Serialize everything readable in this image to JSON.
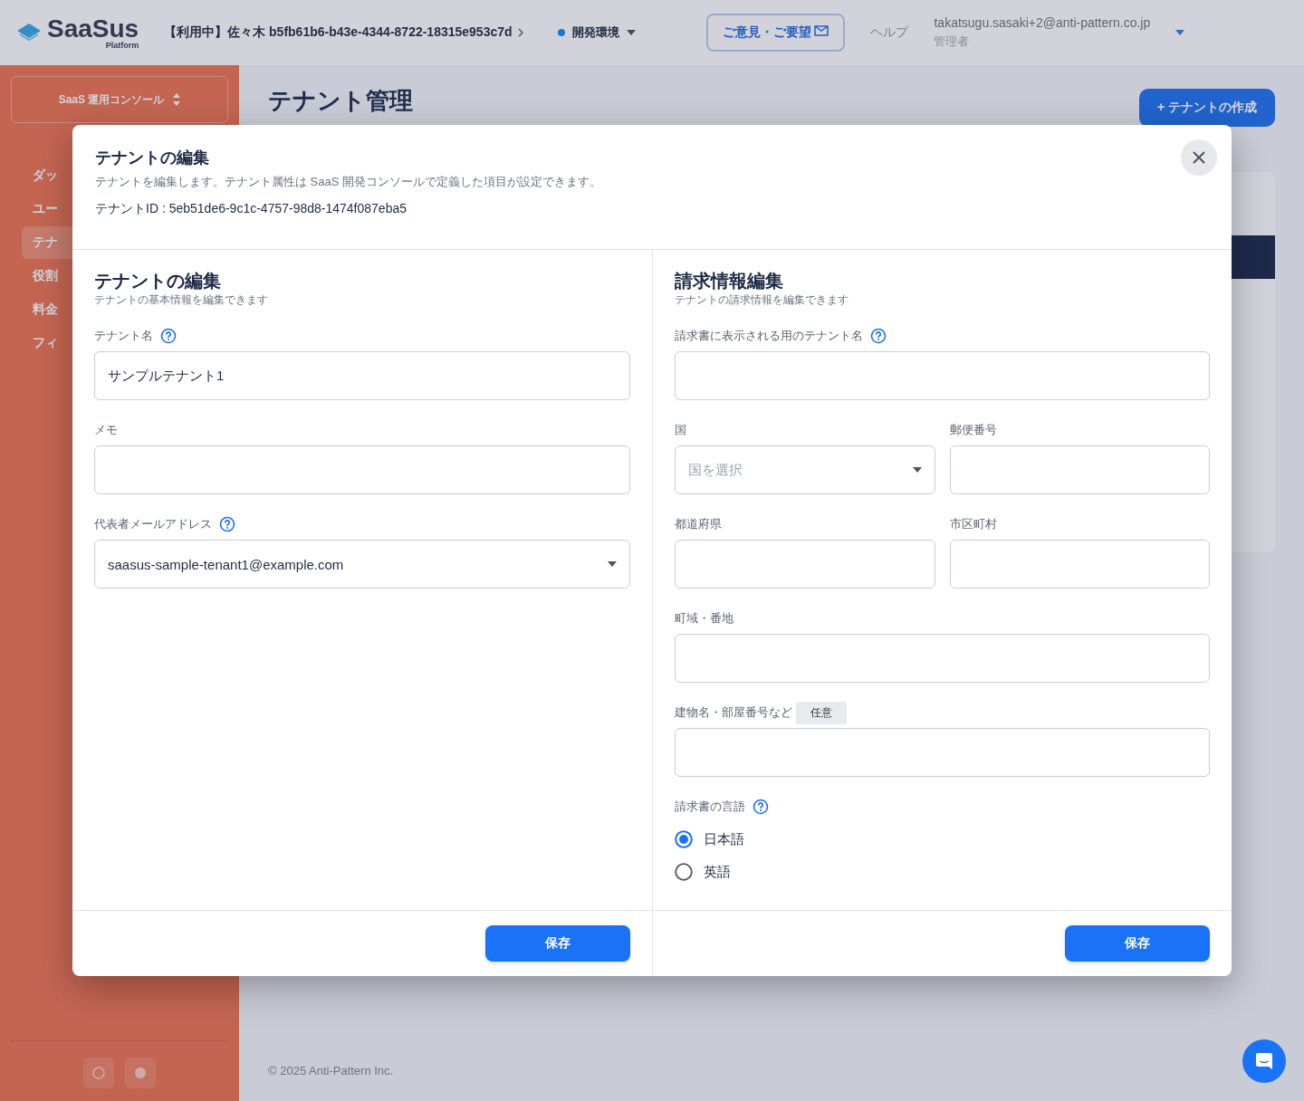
{
  "header": {
    "logo": {
      "name": "SaaSus",
      "sub": "Platform"
    },
    "tenant_selector": "【利用中】佐々木 b5fb61b6-b43e-4344-8722-18315e953c7d",
    "environment": "開発環境",
    "feedback_button": "ご意見・ご要望",
    "help_link": "ヘルプ",
    "user": {
      "email": "takatsugu.sasaki+2@anti-pattern.co.jp",
      "role": "管理者"
    }
  },
  "sidebar": {
    "console_selector": "SaaS 運用コンソール",
    "items": [
      {
        "label": "ダッ",
        "selected": false
      },
      {
        "label": "ユー",
        "selected": false
      },
      {
        "label": "テナ",
        "selected": true
      },
      {
        "label": "役割",
        "selected": false
      },
      {
        "label": "料金",
        "selected": false
      },
      {
        "label": "フィ",
        "selected": false
      }
    ]
  },
  "page": {
    "title": "テナント管理",
    "create_button": "+ テナントの作成",
    "footer": "© 2025 Anti-Pattern Inc."
  },
  "dialog": {
    "title": "テナントの編集",
    "description": "テナントを編集します。テナント属性は SaaS 開発コンソールで定義した項目が設定できます。",
    "tenant_id": "テナントID : 5eb51de6-9c1c-4757-98d8-1474f087eba5",
    "sections": [
      {
        "title": "テナントの編集",
        "subtitle": "テナントの基本情報を編集できます",
        "save_button": "保存",
        "rows": [
          [
            {
              "kind": "text",
              "label": "テナント名",
              "help": true,
              "value": "サンプルテナント1"
            }
          ],
          [
            {
              "kind": "text",
              "label": "メモ",
              "help": false
            }
          ],
          [
            {
              "kind": "select",
              "label": "代表者メールアドレス",
              "help": true,
              "value": "saasus-sample-tenant1@example.com"
            }
          ]
        ]
      },
      {
        "title": "請求情報編集",
        "subtitle": "テナントの請求情報を編集できます",
        "save_button": "保存",
        "rows": [
          [
            {
              "kind": "text",
              "label": "請求書に表示される用のテナント名",
              "help": true
            }
          ],
          [
            {
              "kind": "select",
              "label": "国",
              "help": false,
              "placeholder": "国を選択"
            },
            {
              "kind": "text",
              "label": "郵便番号",
              "help": false
            }
          ],
          [
            {
              "kind": "text",
              "label": "都道府県",
              "help": false
            },
            {
              "kind": "text",
              "label": "市区町村",
              "help": false
            }
          ],
          [
            {
              "kind": "text",
              "label": "町域・番地",
              "help": false
            }
          ],
          [
            {
              "kind": "text",
              "label": "建物名・部屋番号など",
              "help": false,
              "badge": "任意"
            }
          ],
          [
            {
              "kind": "radio",
              "label": "請求書の言語",
              "help": true,
              "options": [
                {
                  "label": "日本語",
                  "selected": true
                },
                {
                  "label": "英語",
                  "selected": false
                }
              ]
            }
          ]
        ]
      }
    ]
  }
}
